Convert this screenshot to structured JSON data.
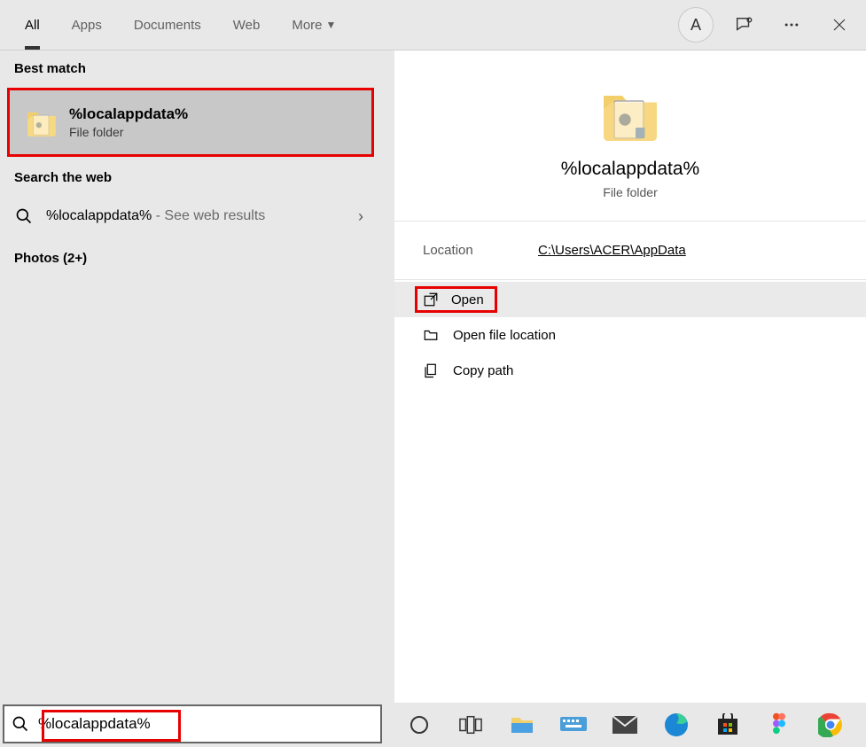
{
  "tabs": {
    "all": "All",
    "apps": "Apps",
    "documents": "Documents",
    "web": "Web",
    "more": "More"
  },
  "avatar_initial": "A",
  "section": {
    "best_match": "Best match",
    "search_web": "Search the web",
    "photos": "Photos (2+)"
  },
  "best_match": {
    "title": "%localappdata%",
    "subtitle": "File folder"
  },
  "web_row": {
    "query": "%localappdata%",
    "suffix": " - See web results"
  },
  "preview": {
    "title": "%localappdata%",
    "subtitle": "File folder",
    "location_label": "Location",
    "location_value": "C:\\Users\\ACER\\AppData"
  },
  "actions": {
    "open": "Open",
    "open_file_location": "Open file location",
    "copy_path": "Copy path"
  },
  "search": {
    "value": "%localappdata%"
  }
}
